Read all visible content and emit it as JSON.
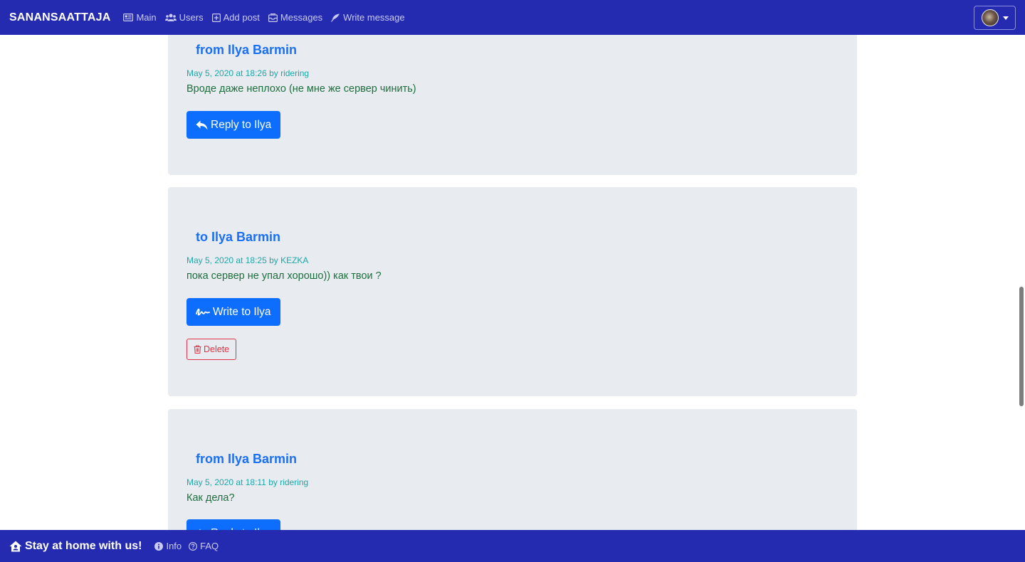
{
  "navbar": {
    "brand": "SANANSAATTAJA",
    "items": [
      {
        "label": "Main",
        "icon": "newspaper-icon"
      },
      {
        "label": "Users",
        "icon": "users-icon"
      },
      {
        "label": "Add post",
        "icon": "plus-square-icon"
      },
      {
        "label": "Messages",
        "icon": "inbox-icon"
      },
      {
        "label": "Write message",
        "icon": "feather-icon"
      }
    ],
    "user_menu_icon": "avatar"
  },
  "messages": [
    {
      "title": "from Ilya Barmin",
      "meta": "May 5, 2020 at 18:26 by ridering",
      "text": "Вроде даже неплохо (не мне же сервер чинить)",
      "button_label": "Reply to Ilya",
      "button_icon": "reply-icon"
    },
    {
      "title": "to Ilya Barmin",
      "meta": "May 5, 2020 at 18:25 by KEZKA",
      "text": "пока сервер не упал хорошо)) как твои ?",
      "button_label": "Write to Ilya",
      "button_icon": "signature-icon",
      "delete_label": "Delete"
    },
    {
      "title": "from Ilya Barmin",
      "meta": "May 5, 2020 at 18:11 by ridering",
      "text": "Как дела?",
      "button_label": "Reply to Ilya",
      "button_icon": "reply-icon"
    }
  ],
  "footer": {
    "brand": "Stay at home with us!",
    "links": [
      {
        "label": "Info",
        "icon": "info-circle-icon"
      },
      {
        "label": "FAQ",
        "icon": "question-circle-icon"
      }
    ]
  },
  "colors": {
    "navbar_bg": "#242bb0",
    "card_bg": "#e8ebef",
    "title": "#1a6ff5",
    "meta": "#20a6a8",
    "text": "#1d6f3e",
    "primary_button": "#0d6efd",
    "danger": "#dc3545"
  }
}
